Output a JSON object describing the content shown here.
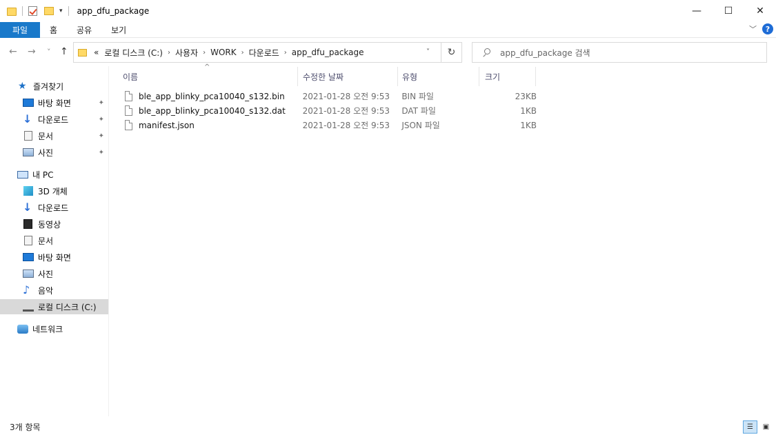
{
  "window": {
    "title": "app_dfu_package",
    "minimize_glyph": "—",
    "maximize_glyph": "☐",
    "close_glyph": "✕"
  },
  "ribbon": {
    "tabs": [
      "파일",
      "홈",
      "공유",
      "보기"
    ],
    "help_glyph": "?",
    "collapse_glyph": "﹀"
  },
  "nav": {
    "back_glyph": "←",
    "forward_glyph": "→",
    "recent_glyph": "˅",
    "up_glyph": "↑"
  },
  "address": {
    "overflow": "«",
    "crumbs": [
      "로컬 디스크 (C:)",
      "사용자",
      "WORK",
      "다운로드",
      "app_dfu_package"
    ],
    "separator": "›",
    "dropdown_glyph": "˅",
    "refresh_glyph": "↻"
  },
  "search": {
    "placeholder": "app_dfu_package 검색"
  },
  "sidebar": {
    "quick_access": "즐겨찾기",
    "quick_items": [
      "바탕 화면",
      "다운로드",
      "문서",
      "사진"
    ],
    "this_pc": "내 PC",
    "pc_items": [
      "3D 개체",
      "다운로드",
      "동영상",
      "문서",
      "바탕 화면",
      "사진",
      "음악",
      "로컬 디스크 (C:)"
    ],
    "network": "네트워크",
    "pin_glyph": "📌"
  },
  "columns": {
    "name": "이름",
    "date": "수정한 날짜",
    "type": "유형",
    "size": "크기",
    "sort_glyph": "^"
  },
  "files": [
    {
      "name": "ble_app_blinky_pca10040_s132.bin",
      "date": "2021-01-28 오전 9:53",
      "type": "BIN 파일",
      "size": "23KB"
    },
    {
      "name": "ble_app_blinky_pca10040_s132.dat",
      "date": "2021-01-28 오전 9:53",
      "type": "DAT 파일",
      "size": "1KB"
    },
    {
      "name": "manifest.json",
      "date": "2021-01-28 오전 9:53",
      "type": "JSON 파일",
      "size": "1KB"
    }
  ],
  "status": {
    "item_count": "3개 항목"
  },
  "colors": {
    "accent": "#1979ca",
    "selected_nav": "#d9d9d9",
    "header_text": "#4d4d6d"
  }
}
